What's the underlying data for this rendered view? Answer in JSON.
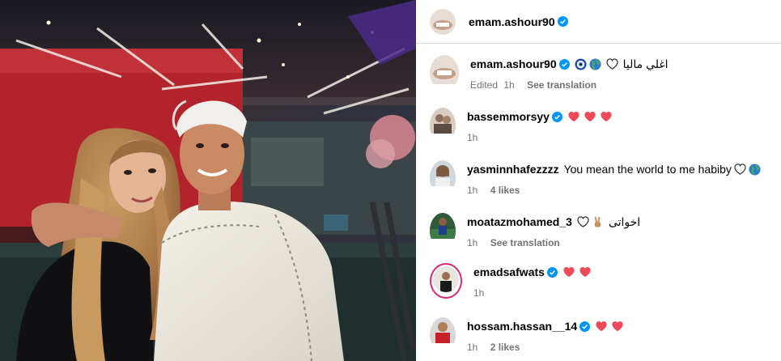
{
  "post": {
    "author": "emam.ashour90",
    "caption_text": "اغلي ماليا",
    "caption_meta_edited": "Edited",
    "caption_meta_time": "1h",
    "caption_meta_translate": "See translation"
  },
  "comments": [
    {
      "username": "bassemmorsyy",
      "text": "",
      "hearts": 3,
      "time": "1h",
      "likes": "",
      "action": ""
    },
    {
      "username": "yasminnhafezzzz",
      "text": "You mean the world to me habiby",
      "hearts": 0,
      "time": "1h",
      "likes": "4 likes",
      "action": ""
    },
    {
      "username": "moatazmohamed_3",
      "text": "اخواتى",
      "hearts": 0,
      "time": "1h",
      "likes": "",
      "action": "See translation"
    },
    {
      "username": "emadsafwats",
      "text": "",
      "hearts": 2,
      "time": "1h",
      "likes": "",
      "action": ""
    },
    {
      "username": "hossam.hassan__14",
      "text": "",
      "hearts": 2,
      "time": "1h",
      "likes": "2 likes",
      "action": ""
    }
  ],
  "icons": {
    "verified": "verified-badge-icon",
    "heart": "red-heart-icon",
    "white_heart": "white-heart-icon",
    "globe": "globe-icon",
    "evil_eye": "nazar-amulet-icon",
    "victory": "victory-hand-icon"
  },
  "colors": {
    "verified_blue": "#0095f6",
    "heart_red": "#ed4956",
    "meta_gray": "#737373",
    "divider": "#dbdbdb"
  }
}
